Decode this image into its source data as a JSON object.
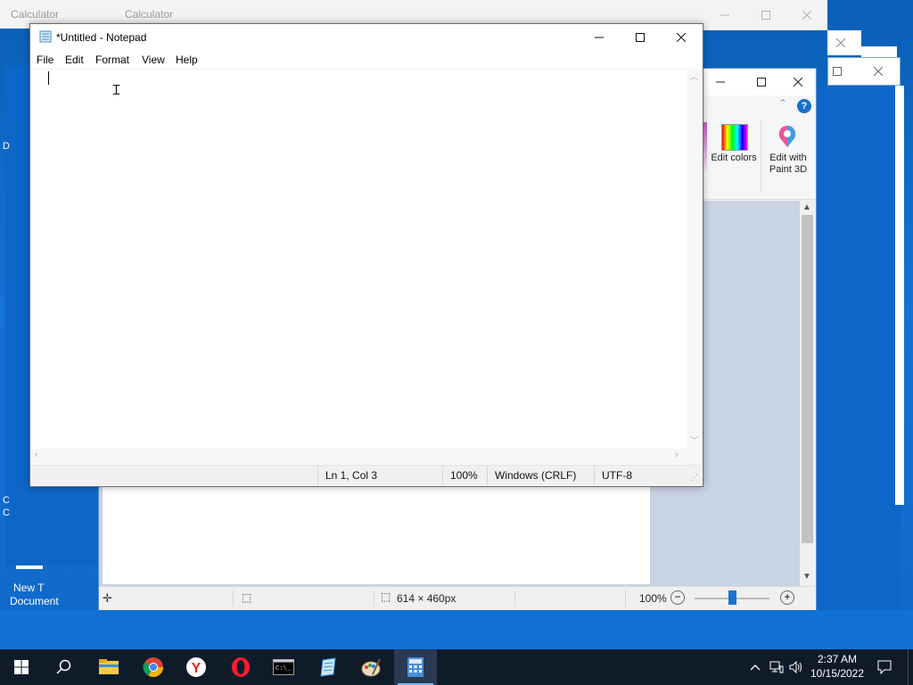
{
  "calculator": {
    "left_title": "Calculator",
    "right_title": "Calculator"
  },
  "notepad": {
    "title": "*Untitled - Notepad",
    "menu": [
      "File",
      "Edit",
      "Format",
      "View",
      "Help"
    ],
    "status": {
      "position": "Ln 1, Col 3",
      "zoom": "100%",
      "line_ending": "Windows (CRLF)",
      "encoding": "UTF-8"
    }
  },
  "paint": {
    "ribbon": {
      "edit_colors": "Edit colors",
      "edit_with_paint3d": "Edit with Paint 3D"
    },
    "status": {
      "dimensions": "614 × 460px",
      "zoom": "100%"
    }
  },
  "desktop": {
    "new_doc_label_1": "New T",
    "new_doc_label_2": "Document",
    "edge_char_1": "D",
    "edge_char_2": "C",
    "edge_char_3": "C"
  },
  "taskbar": {
    "time": "2:37 AM",
    "date": "10/15/2022",
    "apps": [
      "start-icon",
      "search-icon",
      "file-explorer-icon",
      "chrome-icon",
      "yandex-icon",
      "opera-icon",
      "terminal-icon",
      "notepad-icon",
      "paint-icon",
      "calculator-icon"
    ]
  },
  "colors": {
    "desktop_blue": "#0f68c9",
    "taskbar": "#101b2a",
    "accent": "#0078d7"
  }
}
